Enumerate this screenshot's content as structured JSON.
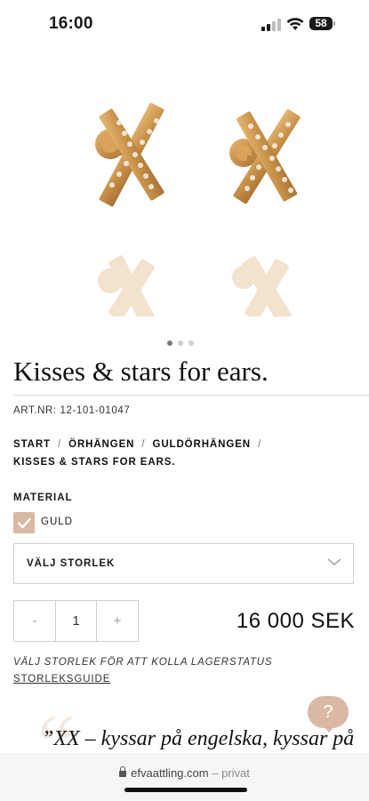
{
  "status_bar": {
    "time": "16:00",
    "battery": "58"
  },
  "gallery": {
    "image_count": 3,
    "active_index": 0,
    "product_image": "gold-cross-stud-earrings-image"
  },
  "product": {
    "title": "Kisses & stars for ears.",
    "art_nr": "ART.NR: 12-101-01047",
    "breadcrumb": [
      "START",
      "ÖRHÄNGEN",
      "GULDÖRHÄNGEN",
      "KISSES & STARS FOR EARS."
    ],
    "breadcrumb_separator": "/",
    "material_label": "MATERIAL",
    "material_option": "GULD",
    "material_checked": true,
    "size_select_label": "VÄLJ STORLEK",
    "qty_minus": "-",
    "qty_value": "1",
    "qty_plus": "+",
    "price": "16 000 SEK",
    "stock_note": "VÄLJ STORLEK FÖR ATT KOLLA LAGERSTATUS",
    "size_guide": "STORLEKSGUIDE"
  },
  "description": {
    "quote_open": "“",
    "quote": "”XX – kyssar på engelska, kyssar på"
  },
  "help_button": {
    "label": "?"
  },
  "browser": {
    "domain": "efvaattling.com",
    "separator": "–",
    "mode": "privat"
  },
  "colors": {
    "accent": "#d9b9a4",
    "gold": "#c9924a",
    "border": "#cfcfcf"
  }
}
